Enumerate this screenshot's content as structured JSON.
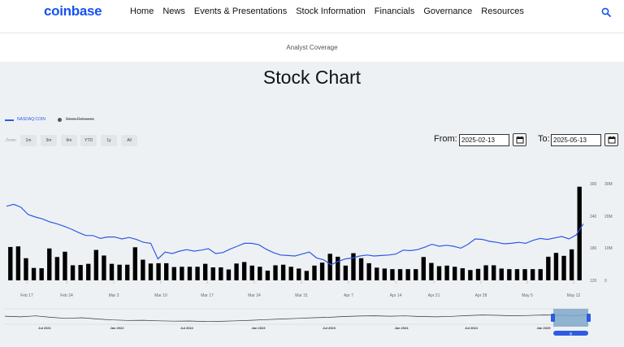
{
  "header": {
    "logo": "coinbase",
    "nav": [
      "Home",
      "News",
      "Events & Presentations",
      "Stock Information",
      "Financials",
      "Governance",
      "Resources"
    ],
    "search_icon": "search-icon"
  },
  "subnav": {
    "item": "Analyst Coverage"
  },
  "page": {
    "title": "Stock Chart"
  },
  "legend": {
    "price_series": "NASDAQ:COIN",
    "news_series": "News Releases"
  },
  "zoom": {
    "label": "Zoom",
    "options": [
      "1m",
      "3m",
      "6m",
      "YTD",
      "1y",
      "All"
    ]
  },
  "range": {
    "from_label": "From:",
    "from_value": "2025-02-13",
    "to_label": "To:",
    "to_value": "2025-05-13"
  },
  "colors": {
    "accent": "#1652f0",
    "price_line": "#2d5be3",
    "volume_bars": "#000000",
    "navigator_mask": "#7fa8c9"
  },
  "chart_data": {
    "type": "line",
    "x_tick_labels": [
      "Feb 17",
      "Feb 24",
      "Mar 3",
      "Mar 10",
      "Mar 17",
      "Mar 24",
      "Mar 31",
      "Apr 7",
      "Apr 14",
      "Apr 21",
      "Apr 28",
      "May 5",
      "May 12"
    ],
    "price_axis_labels": [
      "120",
      "180",
      "240",
      "300"
    ],
    "volume_axis_labels": [
      "0",
      "10M",
      "20M",
      "30M"
    ],
    "price": [
      272,
      276,
      270,
      255,
      250,
      246,
      240,
      236,
      231,
      225,
      218,
      212,
      212,
      206,
      209,
      209,
      205,
      208,
      204,
      198,
      196,
      164,
      178,
      175,
      180,
      183,
      180,
      182,
      185,
      175,
      177,
      184,
      190,
      196,
      196,
      193,
      184,
      177,
      172,
      171,
      170,
      174,
      178,
      166,
      162,
      152,
      159,
      164,
      166,
      170,
      172,
      170,
      171,
      172,
      174,
      182,
      181,
      183,
      188,
      194,
      190,
      192,
      190,
      186,
      194,
      205,
      204,
      200,
      198,
      195,
      196,
      198,
      196,
      202,
      206,
      204,
      207,
      210,
      205,
      213,
      236
    ],
    "volume": [
      11.3,
      11.5,
      7.5,
      4.2,
      4.1,
      10.8,
      7.9,
      9.7,
      5.1,
      5.2,
      5.6,
      10.3,
      8.4,
      5.6,
      5.3,
      5.3,
      11.2,
      7.0,
      5.7,
      5.8,
      5.8,
      4.5,
      4.6,
      4.6,
      4.6,
      5.6,
      4.4,
      4.4,
      3.7,
      5.7,
      6.2,
      5.0,
      4.6,
      3.3,
      5.1,
      5.3,
      4.6,
      4.0,
      3.2,
      5.0,
      6.0,
      9.0,
      8.0,
      5.0,
      9.2,
      7.5,
      5.8,
      4.3,
      4.0,
      3.8,
      3.8,
      3.8,
      3.8,
      7.9,
      5.9,
      4.8,
      5.0,
      4.6,
      4.1,
      3.5,
      3.9,
      5.1,
      5.1,
      4.0,
      3.8,
      3.8,
      3.8,
      3.8,
      3.8,
      8.0,
      9.3,
      8.3,
      10.5,
      31.7
    ],
    "navigator_labels": [
      "Jul 2021",
      "Jan 2022",
      "Jul 2022",
      "Jan 2023",
      "Jul 2023",
      "Jan 2024",
      "Jul 2024",
      "Jan 2025"
    ],
    "navigator_handle_label": "|||"
  }
}
